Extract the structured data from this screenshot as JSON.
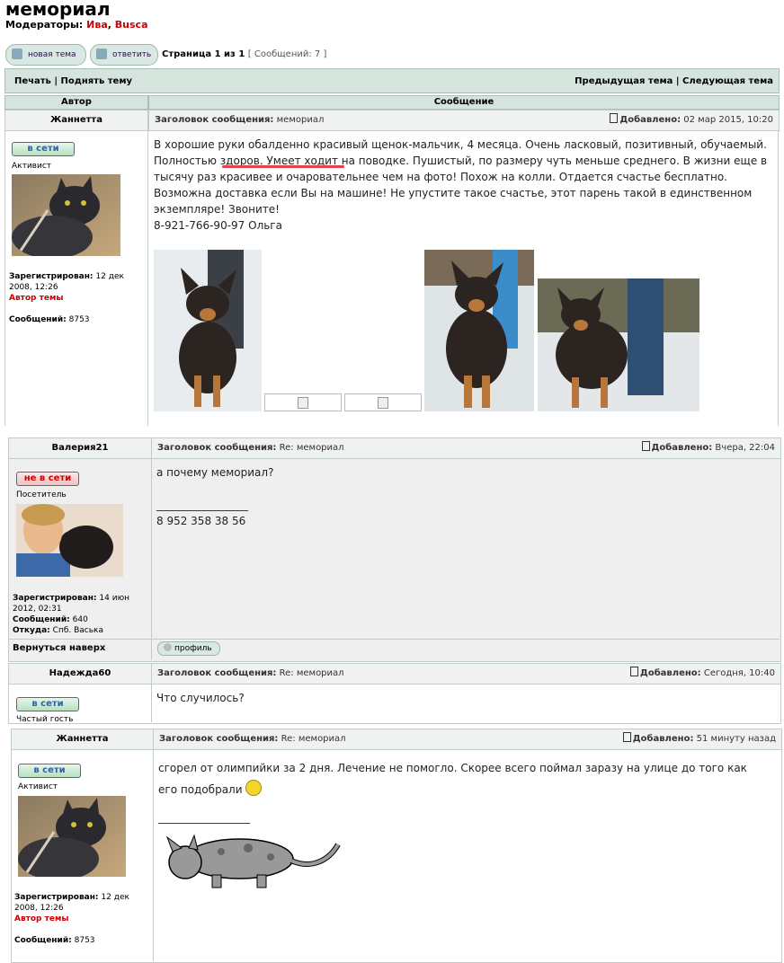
{
  "forum": {
    "title": "мемориал",
    "moderators_label": "Модераторы:",
    "moderator_1": "Ива",
    "moderator_sep": ",",
    "moderator_2": "Busca"
  },
  "toolbar": {
    "new_topic": "новая тема",
    "reply": "ответить",
    "page_label": "Страница 1 из 1",
    "messages_count": "[ Сообщений: 7 ]"
  },
  "topbar": {
    "print": "Печать",
    "raise": "Поднять тему",
    "prev": "Предыдущая тема",
    "next": "Следующая тема",
    "sep": "|"
  },
  "columns": {
    "author": "Автор",
    "message": "Сообщение"
  },
  "labels": {
    "subject": "Заголовок сообщения:",
    "added": "Добавлено:",
    "registered": "Зарегистрирован:",
    "messages": "Сообщений:",
    "from": "Откуда:",
    "topic_author": "Автор темы",
    "back_to_top": "Вернуться наверх",
    "profile": "профиль"
  },
  "posts": [
    {
      "author": "Жаннетта",
      "subject": "мемориал",
      "date": "02 мар 2015, 10:20",
      "status": "в сети",
      "rank": "Активист",
      "registered": "12 дек 2008, 12:26",
      "messages": "8753",
      "text_1": "В хорошие руки обалденно красивый щенок-мальчик, 4 месяца. Очень ласковый, позитивный, обучаемый. Полностью здоров. Умеет ходит на поводке. Пушистый, по размеру чуть меньше среднего. В жизни еще в тысячу раз красивее и очаровательнее чем на фото! Похож на колли. Отдается счастье бесплатно. Возможна доставка если Вы на машине! Не упустите такое счастье, этот парень такой в единственном экземпляре! Звоните!",
      "text_2": "8-921-766-90-97 Ольга"
    },
    {
      "author": "Валерия21",
      "subject": "Re: мемориал",
      "date": "Вчера, 22:04",
      "status": "не в сети",
      "rank": "Посетитель",
      "registered": "14 июн 2012, 02:31",
      "messages": "640",
      "from": "Спб. Васька",
      "text_1": "а почему мемориал?",
      "signature_line": "_________________",
      "signature": "8 952 358 38 56"
    },
    {
      "author": "Надежда60",
      "subject": "Re: мемориал",
      "date": "Сегодня, 10:40",
      "status": "в сети",
      "rank": "Частый гость",
      "text_1": "Что случилось?"
    },
    {
      "author": "Жаннетта",
      "subject": "Re: мемориал",
      "date": "51 минуту назад",
      "status": "в сети",
      "rank": "Активист",
      "registered": "12 дек 2008, 12:26",
      "messages": "8753",
      "text_1": "сгорел от олимпийки за 2 дня. Лечение не помогло. Скорее всего поймал заразу на улице до того как его подобрали",
      "signature_line": "_________________"
    }
  ],
  "colors": {
    "header_bg": "#d6e4de",
    "online": "#2a62b4",
    "offline": "#c00000",
    "link_red": "#c00000"
  }
}
